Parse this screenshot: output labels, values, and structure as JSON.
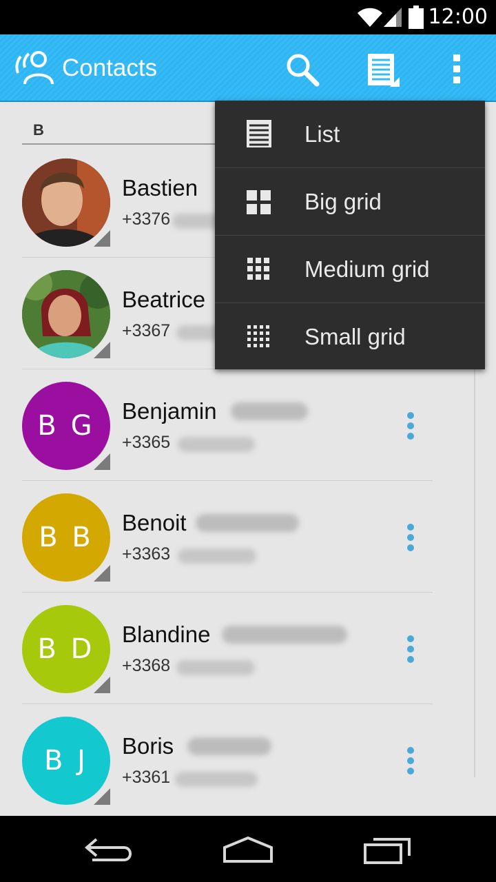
{
  "status_bar": {
    "time": "12:00"
  },
  "action_bar": {
    "title": "Contacts",
    "icons": [
      "contacts-app-icon",
      "search-icon",
      "view-mode-icon",
      "overflow-menu-icon"
    ]
  },
  "list": {
    "section_letter": "B",
    "contacts": [
      {
        "name": "Bastien",
        "phone_prefix": "+3376",
        "avatar_type": "photo",
        "initials": ""
      },
      {
        "name": "Beatrice",
        "phone_prefix": "+3367",
        "avatar_type": "photo",
        "initials": ""
      },
      {
        "name": "Benjamin",
        "phone_prefix": "+3365",
        "avatar_type": "initials",
        "initials": "B G",
        "color": "#9a0ea0"
      },
      {
        "name": "Benoit",
        "phone_prefix": "+3363",
        "avatar_type": "initials",
        "initials": "B B",
        "color": "#d3a800"
      },
      {
        "name": "Blandine",
        "phone_prefix": "+3368",
        "avatar_type": "initials",
        "initials": "B D",
        "color": "#a6c90c"
      },
      {
        "name": "Boris",
        "phone_prefix": "+3361",
        "avatar_type": "initials",
        "initials": "B J",
        "color": "#13c8cf"
      }
    ]
  },
  "popup_menu": {
    "items": [
      {
        "label": "List",
        "icon": "list-view-icon"
      },
      {
        "label": "Big grid",
        "icon": "big-grid-icon"
      },
      {
        "label": "Medium grid",
        "icon": "medium-grid-icon"
      },
      {
        "label": "Small grid",
        "icon": "small-grid-icon"
      }
    ]
  },
  "nav_bar": {
    "buttons": [
      "back-icon",
      "home-icon",
      "recent-apps-icon"
    ]
  },
  "colors": {
    "accent": "#33b5e5",
    "menu_dots": "#4aa9d6",
    "popup_bg": "#2d2d2d"
  }
}
